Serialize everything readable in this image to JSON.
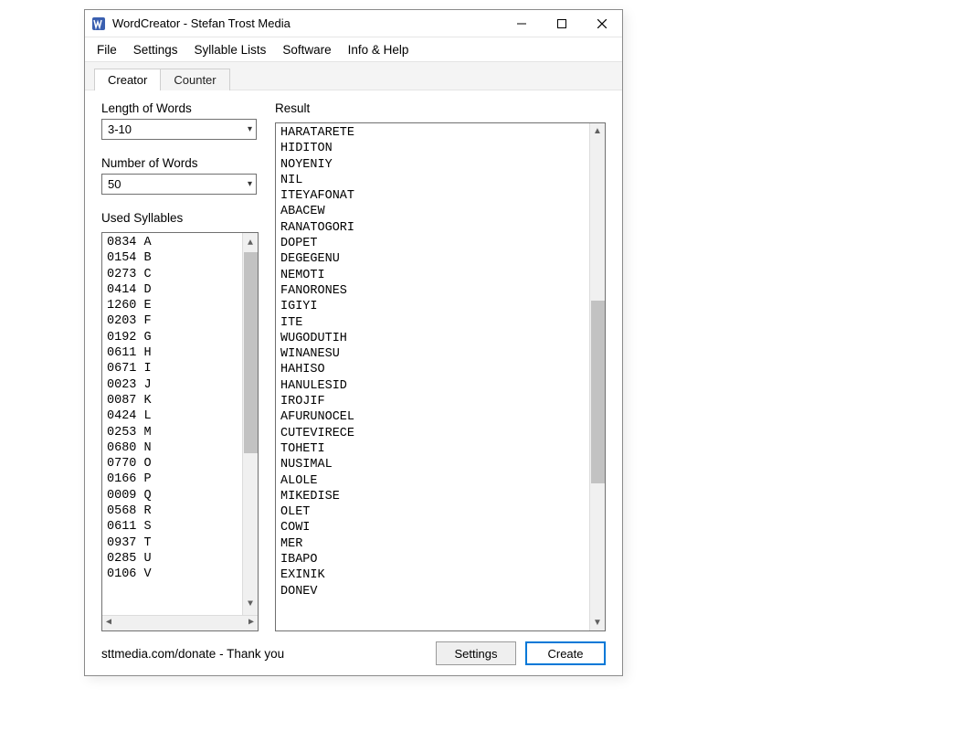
{
  "window": {
    "title": "WordCreator - Stefan Trost Media"
  },
  "menu": {
    "file": "File",
    "settings": "Settings",
    "syllable_lists": "Syllable Lists",
    "software": "Software",
    "info_help": "Info & Help"
  },
  "tabs": {
    "creator": "Creator",
    "counter": "Counter"
  },
  "labels": {
    "length_of_words": "Length of Words",
    "number_of_words": "Number of Words",
    "used_syllables": "Used Syllables",
    "result": "Result"
  },
  "fields": {
    "length_value": "3-10",
    "number_value": "50"
  },
  "syllables_text": "0834 A\n0154 B\n0273 C\n0414 D\n1260 E\n0203 F\n0192 G\n0611 H\n0671 I\n0023 J\n0087 K\n0424 L\n0253 M\n0680 N\n0770 O\n0166 P\n0009 Q\n0568 R\n0611 S\n0937 T\n0285 U\n0106 V",
  "result_text": "HARATARETE\nHIDITON\nNOYENIY\nNIL\nITEYAFONAT\nABACEW\nRANATOGORI\nDOPET\nDEGEGENU\nNEMOTI\nFANORONES\nIGIYI\nITE\nWUGODUTIH\nWINANESU\nHAHISO\nHANULESID\nIROJIF\nAFURUNOCEL\nCUTEVIRECE\nTOHETI\nNUSIMAL\nALOLE\nMIKEDISE\nOLET\nCOWI\nMER\nIBAPO\nEXINIK\nDONEV",
  "bottom": {
    "donate": "sttmedia.com/donate - Thank you",
    "settings_btn": "Settings",
    "create_btn": "Create"
  }
}
